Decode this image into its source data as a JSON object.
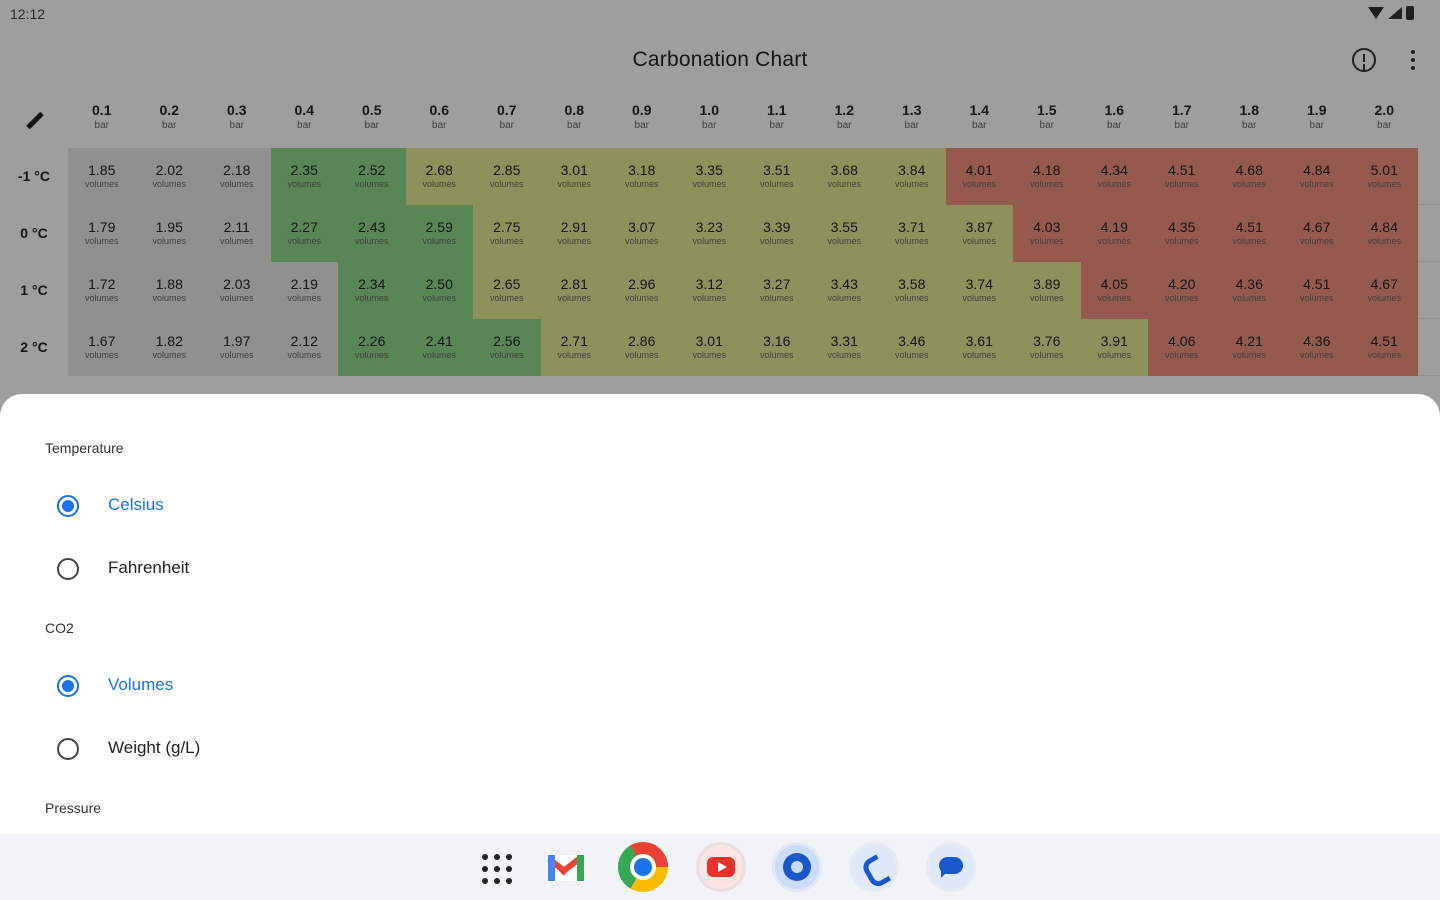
{
  "status_bar": {
    "time": "12:12"
  },
  "app_bar": {
    "title": "Carbonation Chart"
  },
  "table": {
    "column_headers": [
      {
        "value": "0.1",
        "unit": "bar"
      },
      {
        "value": "0.2",
        "unit": "bar"
      },
      {
        "value": "0.3",
        "unit": "bar"
      },
      {
        "value": "0.4",
        "unit": "bar"
      },
      {
        "value": "0.5",
        "unit": "bar"
      },
      {
        "value": "0.6",
        "unit": "bar"
      },
      {
        "value": "0.7",
        "unit": "bar"
      },
      {
        "value": "0.8",
        "unit": "bar"
      },
      {
        "value": "0.9",
        "unit": "bar"
      },
      {
        "value": "1.0",
        "unit": "bar"
      },
      {
        "value": "1.1",
        "unit": "bar"
      },
      {
        "value": "1.2",
        "unit": "bar"
      },
      {
        "value": "1.3",
        "unit": "bar"
      },
      {
        "value": "1.4",
        "unit": "bar"
      },
      {
        "value": "1.5",
        "unit": "bar"
      },
      {
        "value": "1.6",
        "unit": "bar"
      },
      {
        "value": "1.7",
        "unit": "bar"
      },
      {
        "value": "1.8",
        "unit": "bar"
      },
      {
        "value": "1.9",
        "unit": "bar"
      },
      {
        "value": "2.0",
        "unit": "bar"
      }
    ],
    "cell_unit": "volumes",
    "zone_colors": {
      "grey": "#e8e8e8",
      "green": "#8fd98a",
      "yellow": "#e4ec96",
      "red": "#f0917c"
    },
    "rows": [
      {
        "label": "-1 °C",
        "values": [
          "1.85",
          "2.02",
          "2.18",
          "2.35",
          "2.52",
          "2.68",
          "2.85",
          "3.01",
          "3.18",
          "3.35",
          "3.51",
          "3.68",
          "3.84",
          "4.01",
          "4.18",
          "4.34",
          "4.51",
          "4.68",
          "4.84",
          "5.01"
        ],
        "zones": [
          "grey",
          "grey",
          "grey",
          "green",
          "green",
          "yellow",
          "yellow",
          "yellow",
          "yellow",
          "yellow",
          "yellow",
          "yellow",
          "yellow",
          "red",
          "red",
          "red",
          "red",
          "red",
          "red",
          "red"
        ]
      },
      {
        "label": "0 °C",
        "values": [
          "1.79",
          "1.95",
          "2.11",
          "2.27",
          "2.43",
          "2.59",
          "2.75",
          "2.91",
          "3.07",
          "3.23",
          "3.39",
          "3.55",
          "3.71",
          "3.87",
          "4.03",
          "4.19",
          "4.35",
          "4.51",
          "4.67",
          "4.84"
        ],
        "zones": [
          "grey",
          "grey",
          "grey",
          "green",
          "green",
          "green",
          "yellow",
          "yellow",
          "yellow",
          "yellow",
          "yellow",
          "yellow",
          "yellow",
          "yellow",
          "red",
          "red",
          "red",
          "red",
          "red",
          "red"
        ]
      },
      {
        "label": "1 °C",
        "values": [
          "1.72",
          "1.88",
          "2.03",
          "2.19",
          "2.34",
          "2.50",
          "2.65",
          "2.81",
          "2.96",
          "3.12",
          "3.27",
          "3.43",
          "3.58",
          "3.74",
          "3.89",
          "4.05",
          "4.20",
          "4.36",
          "4.51",
          "4.67"
        ],
        "zones": [
          "grey",
          "grey",
          "grey",
          "grey",
          "green",
          "green",
          "yellow",
          "yellow",
          "yellow",
          "yellow",
          "yellow",
          "yellow",
          "yellow",
          "yellow",
          "yellow",
          "red",
          "red",
          "red",
          "red",
          "red"
        ]
      },
      {
        "label": "2 °C",
        "values": [
          "1.67",
          "1.82",
          "1.97",
          "2.12",
          "2.26",
          "2.41",
          "2.56",
          "2.71",
          "2.86",
          "3.01",
          "3.16",
          "3.31",
          "3.46",
          "3.61",
          "3.76",
          "3.91",
          "4.06",
          "4.21",
          "4.36",
          "4.51"
        ],
        "zones": [
          "grey",
          "grey",
          "grey",
          "grey",
          "green",
          "green",
          "green",
          "yellow",
          "yellow",
          "yellow",
          "yellow",
          "yellow",
          "yellow",
          "yellow",
          "yellow",
          "yellow",
          "red",
          "red",
          "red",
          "red"
        ]
      }
    ]
  },
  "sheet": {
    "temperature": {
      "label": "Temperature",
      "options": [
        {
          "label": "Celsius",
          "checked": true
        },
        {
          "label": "Fahrenheit",
          "checked": false
        }
      ]
    },
    "co2": {
      "label": "CO2",
      "options": [
        {
          "label": "Volumes",
          "checked": true
        },
        {
          "label": "Weight (g/L)",
          "checked": false
        }
      ]
    },
    "pressure": {
      "label": "Pressure"
    }
  },
  "taskbar": {
    "icons": [
      "apps-grid-icon",
      "gmail-icon",
      "chrome-icon",
      "youtube-icon",
      "settings-icon",
      "phone-icon",
      "messages-icon"
    ]
  },
  "accent_color": "#1a73e8"
}
